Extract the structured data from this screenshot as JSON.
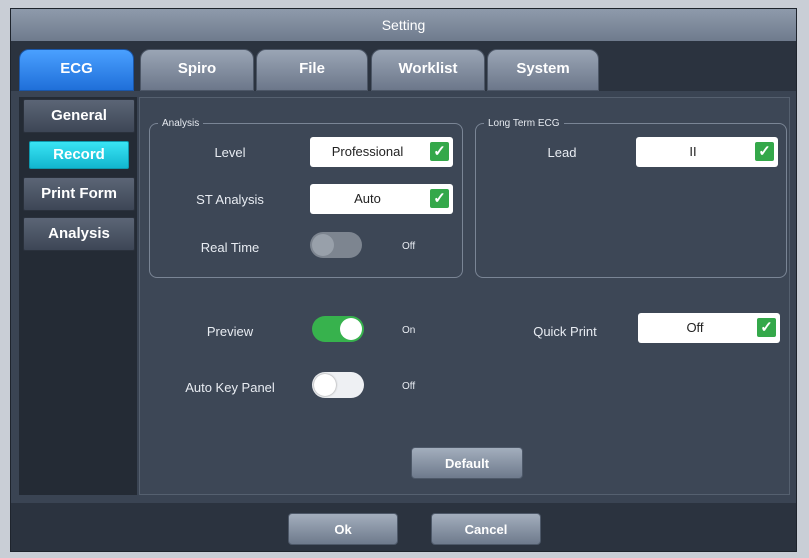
{
  "window": {
    "title": "Setting"
  },
  "tabs": [
    {
      "label": "ECG",
      "active": true
    },
    {
      "label": "Spiro",
      "active": false
    },
    {
      "label": "File",
      "active": false
    },
    {
      "label": "Worklist",
      "active": false
    },
    {
      "label": "System",
      "active": false
    }
  ],
  "sidebar": {
    "items": [
      {
        "label": "General",
        "active": false
      },
      {
        "label": "Record",
        "active": true
      },
      {
        "label": "Print Form",
        "active": false
      },
      {
        "label": "Analysis",
        "active": false
      }
    ]
  },
  "analysis_group": {
    "legend": "Analysis",
    "level_label": "Level",
    "level_value": "Professional",
    "st_label": "ST Analysis",
    "st_value": "Auto",
    "realtime_label": "Real Time",
    "realtime_state": "Off"
  },
  "long_term_group": {
    "legend": "Long Term ECG",
    "lead_label": "Lead",
    "lead_value": "II"
  },
  "preview": {
    "label": "Preview",
    "state": "On"
  },
  "auto_key_panel": {
    "label": "Auto Key Panel",
    "state": "Off"
  },
  "quick_print": {
    "label": "Quick Print",
    "value": "Off"
  },
  "buttons": {
    "default": "Default",
    "ok": "Ok",
    "cancel": "Cancel"
  },
  "colors": {
    "accent_tab": "#1f6fd9",
    "active_side": "#12b6cf",
    "toggle_on": "#37b24d",
    "check": "#34a84a"
  },
  "icons": {
    "check": "check-icon"
  }
}
